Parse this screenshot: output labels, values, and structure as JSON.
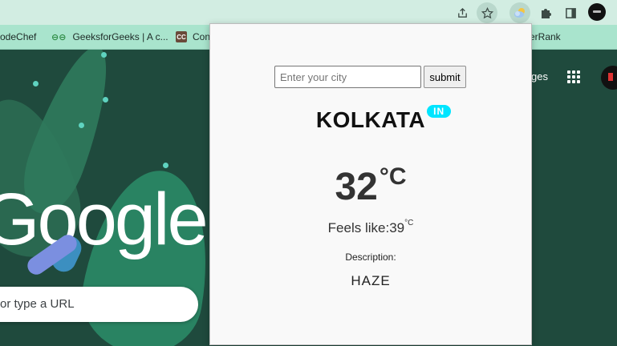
{
  "toolbar": {
    "icons": [
      "share-icon",
      "star-icon",
      "weather-extension-icon",
      "puzzle-icon",
      "side-panel-icon",
      "profile-avatar"
    ]
  },
  "bookmarks": {
    "items": [
      {
        "label": "odeChef"
      },
      {
        "label": "GeeksforGeeks | A c..."
      },
      {
        "label": "Con"
      },
      {
        "label": "erRank"
      }
    ],
    "gfg_icon_glyph": "⊖⊖",
    "cc_icon_glyph": "CC"
  },
  "ntp": {
    "logo_text": "Google",
    "search_placeholder": "or type a URL",
    "images_link": "ges"
  },
  "popup": {
    "city_input_placeholder": "Enter your city",
    "submit_label": "submit",
    "city": "KOLKATA",
    "country_code": "IN",
    "temperature": "32",
    "temperature_unit": "°C",
    "feels_like_label": "Feels like:",
    "feels_like_value": "39",
    "feels_like_unit": "°C",
    "description_label": "Description:",
    "description_value": "HAZE"
  },
  "colors": {
    "toolbar_bg": "#d2ede2",
    "bookmarks_bg": "#a9e4cd",
    "ntp_bg": "#1f4a3d",
    "badge": "#00e5ff"
  }
}
